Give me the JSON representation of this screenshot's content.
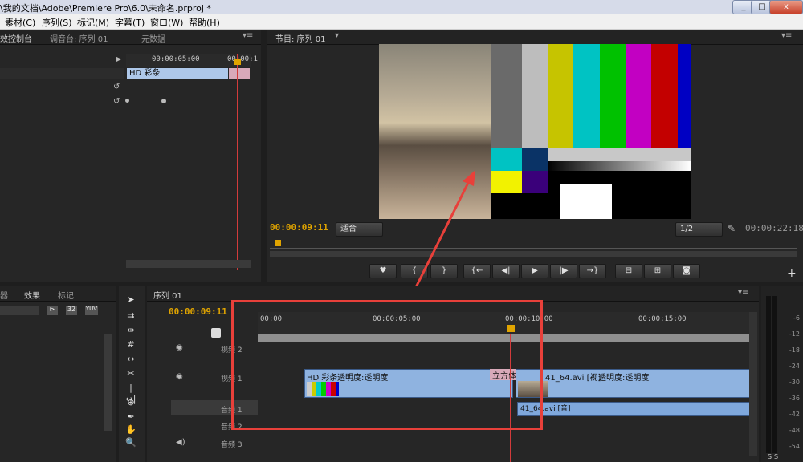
{
  "window": {
    "title": "\\我的文档\\Adobe\\Premiere Pro\\6.0\\未命名.prproj *",
    "min": "_",
    "max": "□",
    "close": "x"
  },
  "menu": [
    "素材(C)",
    "序列(S)",
    "标记(M)",
    "字幕(T)",
    "窗口(W)",
    "帮助(H)"
  ],
  "source_panel": {
    "tabs": [
      "效控制台",
      "调音台: 序列 01",
      "元数据"
    ],
    "ruler_label": "00:00:05:00",
    "ruler_label2": "00:00:1",
    "clip_label": "HD 彩条"
  },
  "program_monitor": {
    "tab": "节目: 序列 01",
    "current_time": "00:00:09:11",
    "fit": "适合",
    "resolution": "1/2",
    "duration": "00:00:22:18"
  },
  "effects_panel": {
    "tabs": [
      "器",
      "效果",
      "标记"
    ],
    "icon_labels": [
      "32",
      "YUV"
    ]
  },
  "timeline": {
    "tab": "序列 01",
    "current_time": "00:00:09:11",
    "ruler": [
      "00:00",
      "00:00:05:00",
      "00:00:10:00",
      "00:00:15:00"
    ],
    "tracks": {
      "video2": "视频 2",
      "video1": "视频 1",
      "audio1": "音频 1",
      "audio2": "音频 2",
      "audio3": "音频 3"
    },
    "clips": {
      "bars": "HD 彩条",
      "bars_effect": "透明度:透明度",
      "transition": "立方体旋转",
      "video_clip": "41_64.avi [视]",
      "video_clip_effect": "透明度:透明度",
      "audio_clip": "41_64.avi [音]"
    }
  },
  "meter": {
    "scale": [
      "-6",
      "-12",
      "-18",
      "-24",
      "-30",
      "-36",
      "-42",
      "-48",
      "-54"
    ],
    "bottom": [
      "S",
      "S"
    ]
  },
  "colors": {
    "timecode": "#e0a400",
    "playhead": "#d23b3b",
    "highlight_box": "#e8403a",
    "clip_video": "#8fb3e0",
    "clip_audio": "#7fa8dc"
  }
}
